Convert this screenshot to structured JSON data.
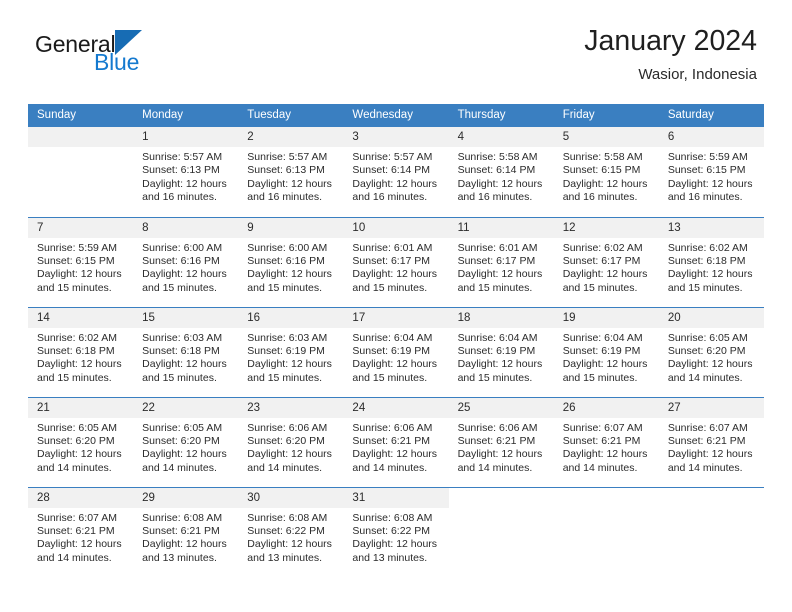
{
  "brand": {
    "name_part1": "General",
    "name_part2": "Blue",
    "triangle_color": "#176cb4",
    "blue_text_color": "#1479cf"
  },
  "header": {
    "title": "January 2024",
    "subtitle": "Wasior, Indonesia"
  },
  "theme": {
    "header_bar_color": "#3a7fc1",
    "daynum_bg": "#f1f1f1",
    "text_color": "#2b2b2b"
  },
  "calendar": {
    "weekday_headers": [
      "Sunday",
      "Monday",
      "Tuesday",
      "Wednesday",
      "Thursday",
      "Friday",
      "Saturday"
    ],
    "weeks": [
      [
        {
          "day": "",
          "sunrise": "",
          "sunset": "",
          "daylight1": "",
          "daylight2": "",
          "blank": true
        },
        {
          "day": "1",
          "sunrise": "Sunrise: 5:57 AM",
          "sunset": "Sunset: 6:13 PM",
          "daylight1": "Daylight: 12 hours",
          "daylight2": "and 16 minutes."
        },
        {
          "day": "2",
          "sunrise": "Sunrise: 5:57 AM",
          "sunset": "Sunset: 6:13 PM",
          "daylight1": "Daylight: 12 hours",
          "daylight2": "and 16 minutes."
        },
        {
          "day": "3",
          "sunrise": "Sunrise: 5:57 AM",
          "sunset": "Sunset: 6:14 PM",
          "daylight1": "Daylight: 12 hours",
          "daylight2": "and 16 minutes."
        },
        {
          "day": "4",
          "sunrise": "Sunrise: 5:58 AM",
          "sunset": "Sunset: 6:14 PM",
          "daylight1": "Daylight: 12 hours",
          "daylight2": "and 16 minutes."
        },
        {
          "day": "5",
          "sunrise": "Sunrise: 5:58 AM",
          "sunset": "Sunset: 6:15 PM",
          "daylight1": "Daylight: 12 hours",
          "daylight2": "and 16 minutes."
        },
        {
          "day": "6",
          "sunrise": "Sunrise: 5:59 AM",
          "sunset": "Sunset: 6:15 PM",
          "daylight1": "Daylight: 12 hours",
          "daylight2": "and 16 minutes."
        }
      ],
      [
        {
          "day": "7",
          "sunrise": "Sunrise: 5:59 AM",
          "sunset": "Sunset: 6:15 PM",
          "daylight1": "Daylight: 12 hours",
          "daylight2": "and 15 minutes."
        },
        {
          "day": "8",
          "sunrise": "Sunrise: 6:00 AM",
          "sunset": "Sunset: 6:16 PM",
          "daylight1": "Daylight: 12 hours",
          "daylight2": "and 15 minutes."
        },
        {
          "day": "9",
          "sunrise": "Sunrise: 6:00 AM",
          "sunset": "Sunset: 6:16 PM",
          "daylight1": "Daylight: 12 hours",
          "daylight2": "and 15 minutes."
        },
        {
          "day": "10",
          "sunrise": "Sunrise: 6:01 AM",
          "sunset": "Sunset: 6:17 PM",
          "daylight1": "Daylight: 12 hours",
          "daylight2": "and 15 minutes."
        },
        {
          "day": "11",
          "sunrise": "Sunrise: 6:01 AM",
          "sunset": "Sunset: 6:17 PM",
          "daylight1": "Daylight: 12 hours",
          "daylight2": "and 15 minutes."
        },
        {
          "day": "12",
          "sunrise": "Sunrise: 6:02 AM",
          "sunset": "Sunset: 6:17 PM",
          "daylight1": "Daylight: 12 hours",
          "daylight2": "and 15 minutes."
        },
        {
          "day": "13",
          "sunrise": "Sunrise: 6:02 AM",
          "sunset": "Sunset: 6:18 PM",
          "daylight1": "Daylight: 12 hours",
          "daylight2": "and 15 minutes."
        }
      ],
      [
        {
          "day": "14",
          "sunrise": "Sunrise: 6:02 AM",
          "sunset": "Sunset: 6:18 PM",
          "daylight1": "Daylight: 12 hours",
          "daylight2": "and 15 minutes."
        },
        {
          "day": "15",
          "sunrise": "Sunrise: 6:03 AM",
          "sunset": "Sunset: 6:18 PM",
          "daylight1": "Daylight: 12 hours",
          "daylight2": "and 15 minutes."
        },
        {
          "day": "16",
          "sunrise": "Sunrise: 6:03 AM",
          "sunset": "Sunset: 6:19 PM",
          "daylight1": "Daylight: 12 hours",
          "daylight2": "and 15 minutes."
        },
        {
          "day": "17",
          "sunrise": "Sunrise: 6:04 AM",
          "sunset": "Sunset: 6:19 PM",
          "daylight1": "Daylight: 12 hours",
          "daylight2": "and 15 minutes."
        },
        {
          "day": "18",
          "sunrise": "Sunrise: 6:04 AM",
          "sunset": "Sunset: 6:19 PM",
          "daylight1": "Daylight: 12 hours",
          "daylight2": "and 15 minutes."
        },
        {
          "day": "19",
          "sunrise": "Sunrise: 6:04 AM",
          "sunset": "Sunset: 6:19 PM",
          "daylight1": "Daylight: 12 hours",
          "daylight2": "and 15 minutes."
        },
        {
          "day": "20",
          "sunrise": "Sunrise: 6:05 AM",
          "sunset": "Sunset: 6:20 PM",
          "daylight1": "Daylight: 12 hours",
          "daylight2": "and 14 minutes."
        }
      ],
      [
        {
          "day": "21",
          "sunrise": "Sunrise: 6:05 AM",
          "sunset": "Sunset: 6:20 PM",
          "daylight1": "Daylight: 12 hours",
          "daylight2": "and 14 minutes."
        },
        {
          "day": "22",
          "sunrise": "Sunrise: 6:05 AM",
          "sunset": "Sunset: 6:20 PM",
          "daylight1": "Daylight: 12 hours",
          "daylight2": "and 14 minutes."
        },
        {
          "day": "23",
          "sunrise": "Sunrise: 6:06 AM",
          "sunset": "Sunset: 6:20 PM",
          "daylight1": "Daylight: 12 hours",
          "daylight2": "and 14 minutes."
        },
        {
          "day": "24",
          "sunrise": "Sunrise: 6:06 AM",
          "sunset": "Sunset: 6:21 PM",
          "daylight1": "Daylight: 12 hours",
          "daylight2": "and 14 minutes."
        },
        {
          "day": "25",
          "sunrise": "Sunrise: 6:06 AM",
          "sunset": "Sunset: 6:21 PM",
          "daylight1": "Daylight: 12 hours",
          "daylight2": "and 14 minutes."
        },
        {
          "day": "26",
          "sunrise": "Sunrise: 6:07 AM",
          "sunset": "Sunset: 6:21 PM",
          "daylight1": "Daylight: 12 hours",
          "daylight2": "and 14 minutes."
        },
        {
          "day": "27",
          "sunrise": "Sunrise: 6:07 AM",
          "sunset": "Sunset: 6:21 PM",
          "daylight1": "Daylight: 12 hours",
          "daylight2": "and 14 minutes."
        }
      ],
      [
        {
          "day": "28",
          "sunrise": "Sunrise: 6:07 AM",
          "sunset": "Sunset: 6:21 PM",
          "daylight1": "Daylight: 12 hours",
          "daylight2": "and 14 minutes."
        },
        {
          "day": "29",
          "sunrise": "Sunrise: 6:08 AM",
          "sunset": "Sunset: 6:21 PM",
          "daylight1": "Daylight: 12 hours",
          "daylight2": "and 13 minutes."
        },
        {
          "day": "30",
          "sunrise": "Sunrise: 6:08 AM",
          "sunset": "Sunset: 6:22 PM",
          "daylight1": "Daylight: 12 hours",
          "daylight2": "and 13 minutes."
        },
        {
          "day": "31",
          "sunrise": "Sunrise: 6:08 AM",
          "sunset": "Sunset: 6:22 PM",
          "daylight1": "Daylight: 12 hours",
          "daylight2": "and 13 minutes."
        },
        {
          "day": "",
          "sunrise": "",
          "sunset": "",
          "daylight1": "",
          "daylight2": "",
          "blank": true,
          "nofill": true
        },
        {
          "day": "",
          "sunrise": "",
          "sunset": "",
          "daylight1": "",
          "daylight2": "",
          "blank": true,
          "nofill": true
        },
        {
          "day": "",
          "sunrise": "",
          "sunset": "",
          "daylight1": "",
          "daylight2": "",
          "blank": true,
          "nofill": true
        }
      ]
    ]
  }
}
